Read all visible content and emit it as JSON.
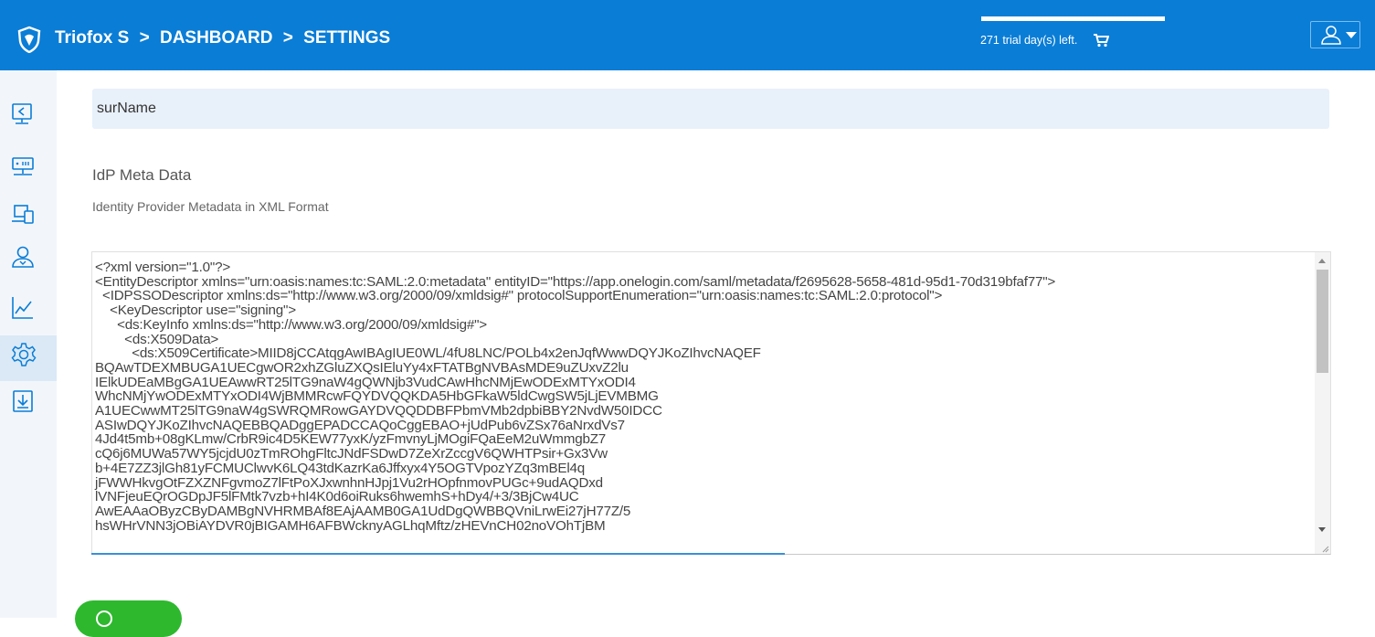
{
  "header": {
    "app_name": "Triofox S",
    "crumbs": [
      ">",
      "DASHBOARD",
      ">",
      "SETTINGS"
    ],
    "trial_text": "271 trial day(s) left.",
    "cart_icon": "shopping-cart-icon",
    "user_icon": "user-icon"
  },
  "sidebar": {
    "items": [
      {
        "icon": "monitor-share-icon"
      },
      {
        "icon": "network-server-icon"
      },
      {
        "icon": "devices-icon"
      },
      {
        "icon": "users-icon"
      },
      {
        "icon": "chart-icon"
      },
      {
        "icon": "gear-icon",
        "active": true
      },
      {
        "icon": "download-icon"
      }
    ]
  },
  "form": {
    "surname_value": "surName",
    "section_title": "IdP Meta Data",
    "section_desc": "Identity Provider Metadata in XML Format",
    "xml_value": "<?xml version=\"1.0\"?>\n<EntityDescriptor xmlns=\"urn:oasis:names:tc:SAML:2.0:metadata\" entityID=\"https://app.onelogin.com/saml/metadata/f2695628-5658-481d-95d1-70d319bfaf77\">\n  <IDPSSODescriptor xmlns:ds=\"http://www.w3.org/2000/09/xmldsig#\" protocolSupportEnumeration=\"urn:oasis:names:tc:SAML:2.0:protocol\">\n    <KeyDescriptor use=\"signing\">\n      <ds:KeyInfo xmlns:ds=\"http://www.w3.org/2000/09/xmldsig#\">\n        <ds:X509Data>\n          <ds:X509Certificate>MIID8jCCAtqgAwIBAgIUE0WL/4fU8LNC/POLb4x2enJqfWwwDQYJKoZIhvcNAQEF\nBQAwTDEXMBUGA1UECgwOR2xhZGluZXQsIEluYy4xFTATBgNVBAsMDE9uZUxvZ2lu\nIElkUDEaMBgGA1UEAwwRT25lTG9naW4gQWNjb3VudCAwHhcNMjEwODExMTYxODI4\nWhcNMjYwODExMTYxODI4WjBMMRcwFQYDVQQKDA5HbGFkaW5ldCwgSW5jLjEVMBMG\nA1UECwwMT25lTG9naW4gSWRQMRowGAYDVQQDDBFPbmVMb2dpbiBBY2NvdW50IDCC\nASIwDQYJKoZIhvcNAQEBBQADggEPADCCAQoCggEBAO+jUdPub6vZSx76aNrxdVs7\n4Jd4t5mb+08gKLmw/CrbR9ic4D5KEW77yxK/yzFmvnyLjMOgiFQaEeM2uWmmgbZ7\ncQ6j6MUWa57WY5jcjdU0zTmROhgFltcJNdFSDwD7ZeXrZccgV6QWHTPsir+Gx3Vw\nb+4E7ZZ3jlGh81yFCMUClwvK6LQ43tdKazrKa6Jffxyx4Y5OGTVpozYZq3mBEl4q\njFWWHkvgOtFZXZNFgvmoZ7lFtPoXJxwnhnHJpj1Vu2rHOpfnmovPUGc+9udAQDxd\nlVNFjeuEQrOGDpJF5lFMtk7vzb+hI4K0d6oiRuks6hwemhS+hDy4/+3/3BjCw4UC\nAwEAAaOByzCByDAMBgNVHRMBAf8EAjAAMB0GA1UdDgQWBBQVniLrwEi27jH77Z/5\nhsWHrVNN3jOBiAYDVR0jBIGAMH6AFBWcknyAGLhqMftz/zHEVnCH02noVOhTjBM"
  },
  "save": {
    "icon": "save-icon",
    "color": "#2eb82e"
  },
  "colors": {
    "header": "#0a7dd6",
    "sidebar_bg": "#f2f6fb",
    "input_bg": "#e8f0fa"
  }
}
